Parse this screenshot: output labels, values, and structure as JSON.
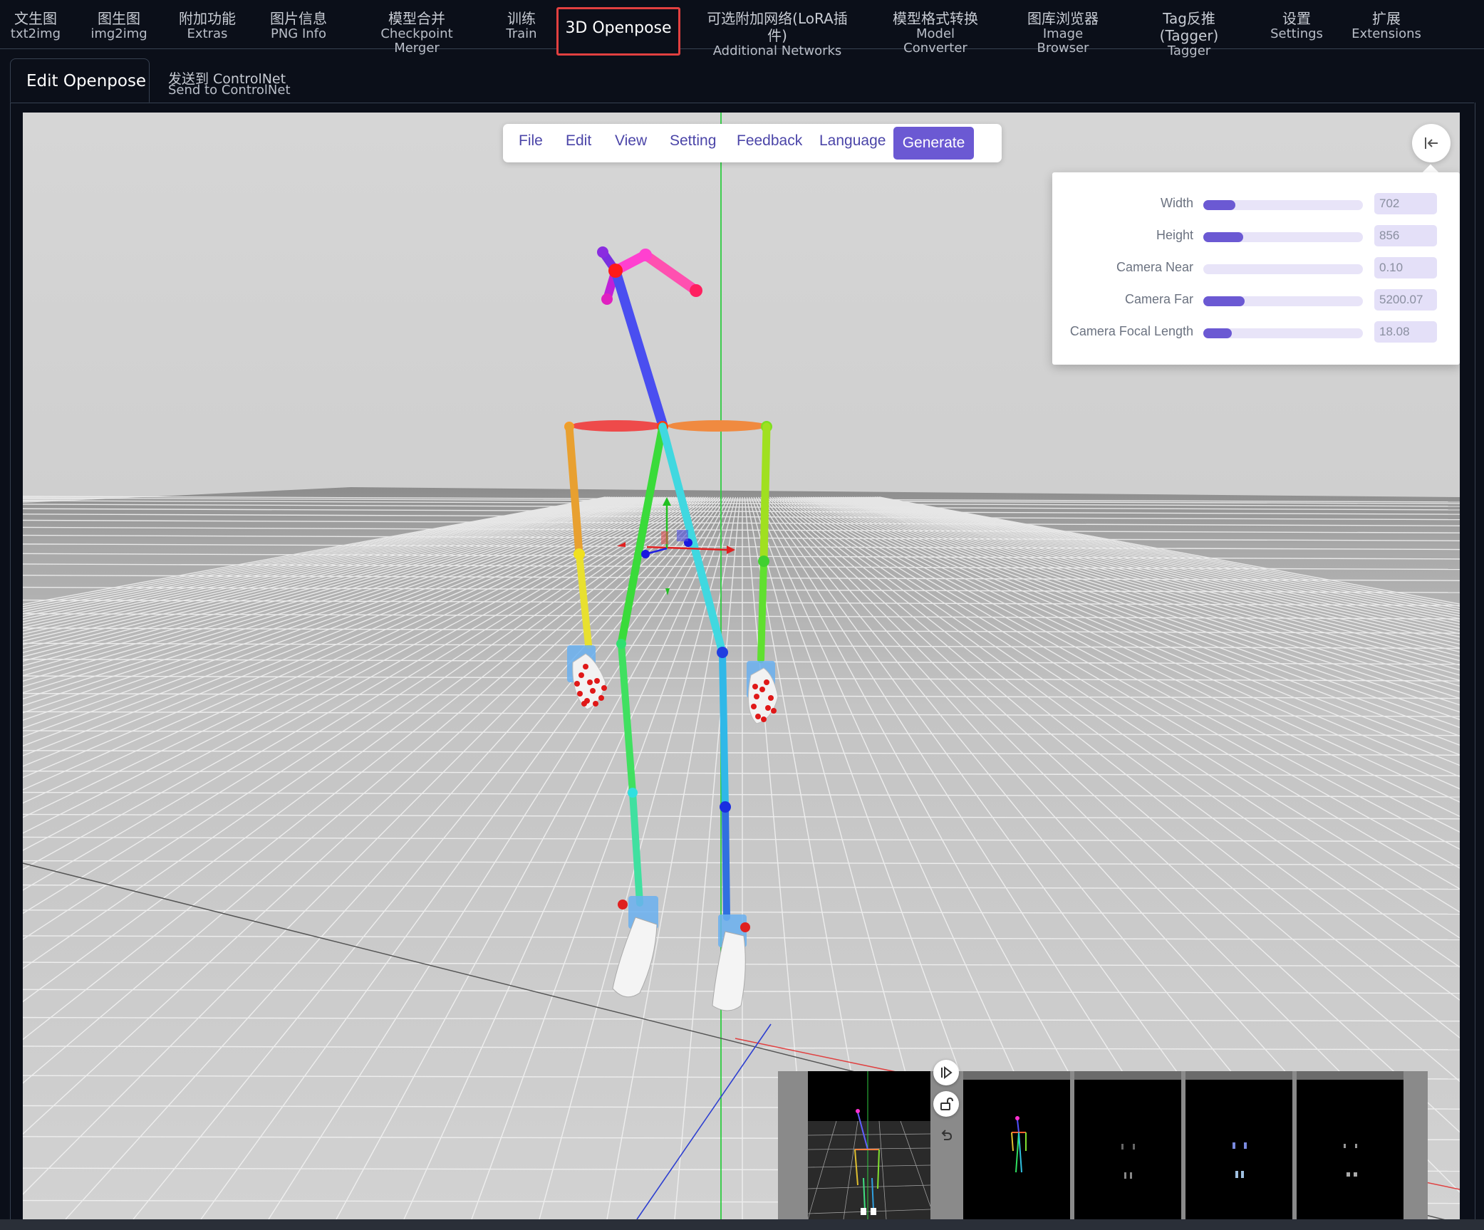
{
  "top_tabs": [
    {
      "zh": "文生图",
      "en": "txt2img"
    },
    {
      "zh": "图生图",
      "en": "img2img"
    },
    {
      "zh": "附加功能",
      "en": "Extras"
    },
    {
      "zh": "图片信息",
      "en": "PNG Info"
    },
    {
      "zh": "模型合并",
      "en": "Checkpoint Merger"
    },
    {
      "zh": "训练",
      "en": "Train"
    },
    {
      "label": "3D Openpose",
      "active": true
    },
    {
      "zh": "可选附加网络(LoRA插件)",
      "en": "Additional Networks"
    },
    {
      "zh": "模型格式转换",
      "en": "Model Converter"
    },
    {
      "zh": "图库浏览器",
      "en": "Image Browser"
    },
    {
      "zh": "Tag反推(Tagger)",
      "en": "Tagger"
    },
    {
      "zh": "设置",
      "en": "Settings"
    },
    {
      "zh": "扩展",
      "en": "Extensions"
    }
  ],
  "sub_tabs": {
    "active_label": "Edit Openpose",
    "second_zh": "发送到 ControlNet",
    "second_en": "Send to ControlNet"
  },
  "menu": {
    "items": [
      "File",
      "Edit",
      "View",
      "Setting",
      "Feedback",
      "Language"
    ],
    "generate": "Generate"
  },
  "panel": {
    "rows": [
      {
        "label": "Width",
        "value": "702",
        "fill": 0.2
      },
      {
        "label": "Height",
        "value": "856",
        "fill": 0.25
      },
      {
        "label": "Camera Near",
        "value": "0.10",
        "fill": 0.0
      },
      {
        "label": "Camera Far",
        "value": "5200.07",
        "fill": 0.26
      },
      {
        "label": "Camera Focal Length",
        "value": "18.08",
        "fill": 0.18
      }
    ]
  },
  "icons": {
    "collapse": "collapse-left-icon",
    "play": "play-icon",
    "lock": "unlock-icon",
    "undo": "undo-icon"
  },
  "colors": {
    "accent": "#6b59d3",
    "active_tab_border": "#e24040",
    "viewport_bg": "#d4d4d4"
  }
}
